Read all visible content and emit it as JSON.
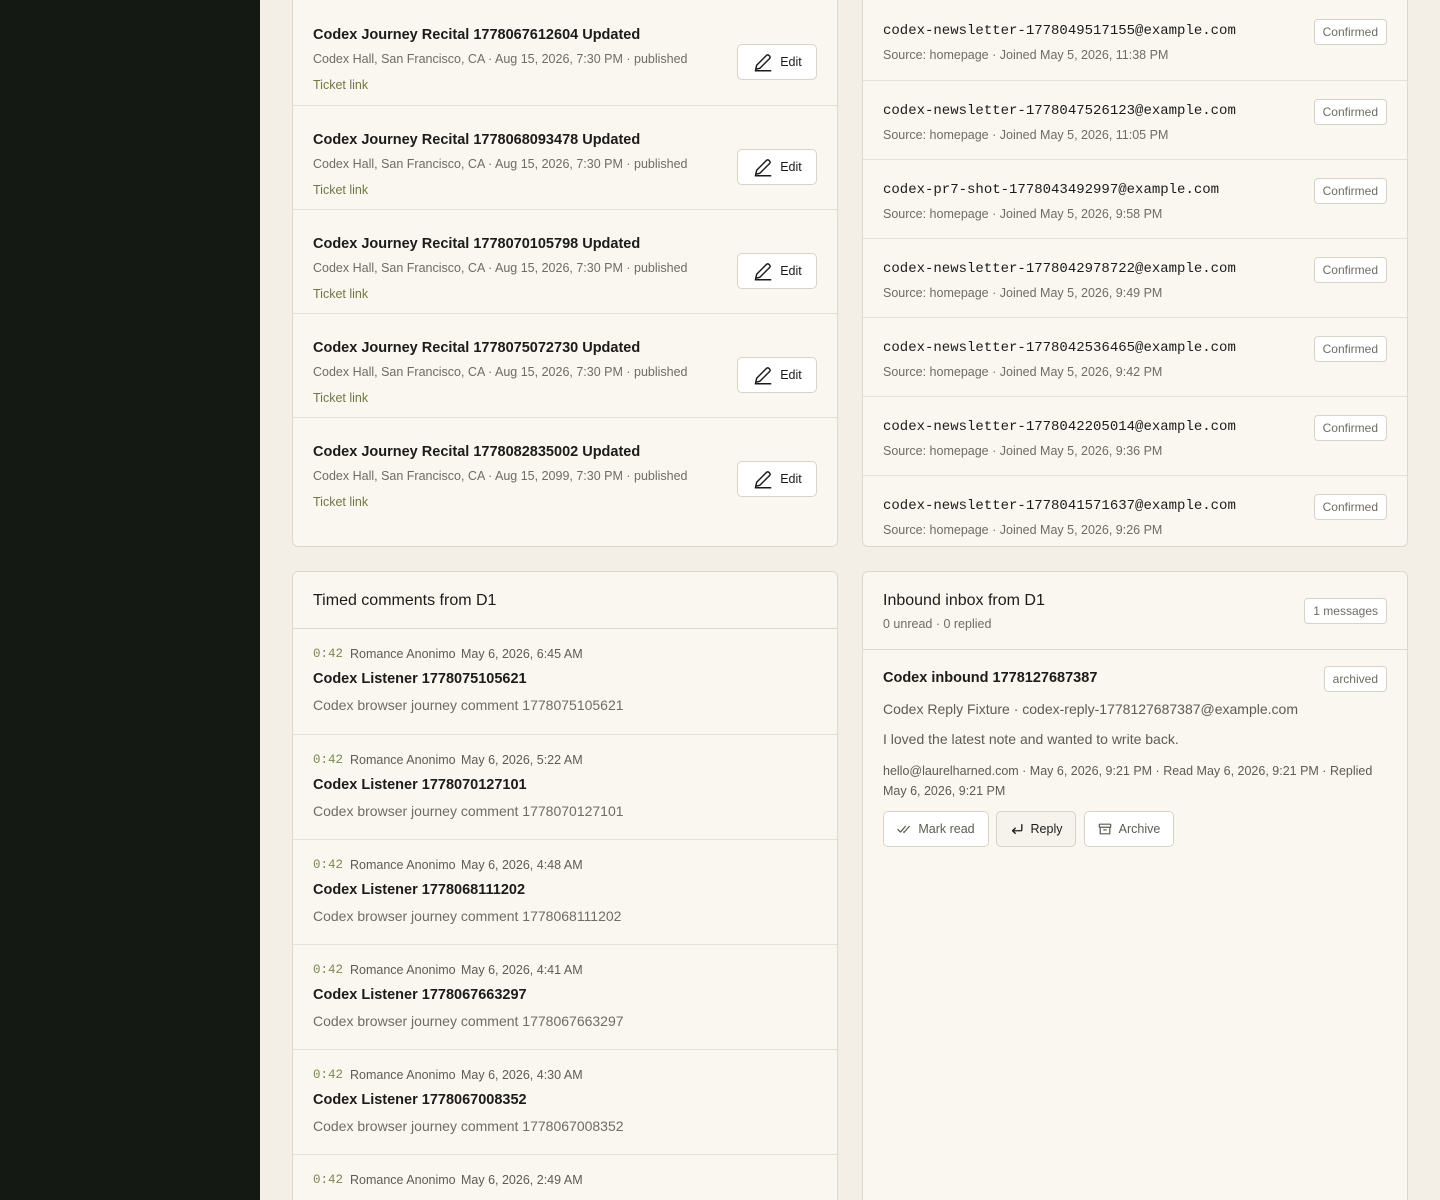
{
  "events": {
    "edit_label": "Edit",
    "items": [
      {
        "title": "Codex Journey Recital 1778067612604 Updated",
        "meta": "Codex Hall, San Francisco, CA · Aug 15, 2026, 7:30 PM · published",
        "link": "Ticket link"
      },
      {
        "title": "Codex Journey Recital 1778068093478 Updated",
        "meta": "Codex Hall, San Francisco, CA · Aug 15, 2026, 7:30 PM · published",
        "link": "Ticket link"
      },
      {
        "title": "Codex Journey Recital 1778070105798 Updated",
        "meta": "Codex Hall, San Francisco, CA · Aug 15, 2026, 7:30 PM · published",
        "link": "Ticket link"
      },
      {
        "title": "Codex Journey Recital 1778075072730 Updated",
        "meta": "Codex Hall, San Francisco, CA · Aug 15, 2026, 7:30 PM · published",
        "link": "Ticket link"
      },
      {
        "title": "Codex Journey Recital 1778082835002 Updated",
        "meta": "Codex Hall, San Francisco, CA · Aug 15, 2099, 7:30 PM · published",
        "link": "Ticket link"
      }
    ]
  },
  "subscribers": {
    "items": [
      {
        "email": "codex-newsletter-1778049517155@example.com",
        "meta": "Source: homepage · Joined May 5, 2026, 11:38 PM",
        "status": "Confirmed"
      },
      {
        "email": "codex-newsletter-1778047526123@example.com",
        "meta": "Source: homepage · Joined May 5, 2026, 11:05 PM",
        "status": "Confirmed"
      },
      {
        "email": "codex-pr7-shot-1778043492997@example.com",
        "meta": "Source: homepage · Joined May 5, 2026, 9:58 PM",
        "status": "Confirmed"
      },
      {
        "email": "codex-newsletter-1778042978722@example.com",
        "meta": "Source: homepage · Joined May 5, 2026, 9:49 PM",
        "status": "Confirmed"
      },
      {
        "email": "codex-newsletter-1778042536465@example.com",
        "meta": "Source: homepage · Joined May 5, 2026, 9:42 PM",
        "status": "Confirmed"
      },
      {
        "email": "codex-newsletter-1778042205014@example.com",
        "meta": "Source: homepage · Joined May 5, 2026, 9:36 PM",
        "status": "Confirmed"
      },
      {
        "email": "codex-newsletter-1778041571637@example.com",
        "meta": "Source: homepage · Joined May 5, 2026, 9:26 PM",
        "status": "Confirmed"
      }
    ]
  },
  "comments": {
    "title": "Timed comments from D1",
    "items": [
      {
        "time": "0:42",
        "author": "Romance Anonimo",
        "date": "May 6, 2026, 6:45 AM",
        "name": "Codex Listener 1778075105621",
        "body": "Codex browser journey comment 1778075105621"
      },
      {
        "time": "0:42",
        "author": "Romance Anonimo",
        "date": "May 6, 2026, 5:22 AM",
        "name": "Codex Listener 1778070127101",
        "body": "Codex browser journey comment 1778070127101"
      },
      {
        "time": "0:42",
        "author": "Romance Anonimo",
        "date": "May 6, 2026, 4:48 AM",
        "name": "Codex Listener 1778068111202",
        "body": "Codex browser journey comment 1778068111202"
      },
      {
        "time": "0:42",
        "author": "Romance Anonimo",
        "date": "May 6, 2026, 4:41 AM",
        "name": "Codex Listener 1778067663297",
        "body": "Codex browser journey comment 1778067663297"
      },
      {
        "time": "0:42",
        "author": "Romance Anonimo",
        "date": "May 6, 2026, 4:30 AM",
        "name": "Codex Listener 1778067008352",
        "body": "Codex browser journey comment 1778067008352"
      },
      {
        "time": "0:42",
        "author": "Romance Anonimo",
        "date": "May 6, 2026, 2:49 AM",
        "name": "",
        "body": ""
      }
    ]
  },
  "inbox": {
    "title": "Inbound inbox from D1",
    "subtitle": "0 unread · 0 replied",
    "count": "1 messages",
    "message": {
      "subject": "Codex inbound 1778127687387",
      "status": "archived",
      "from": "Codex Reply Fixture · codex-reply-1778127687387@example.com",
      "body": "I loved the latest note and wanted to write back.",
      "meta": "hello@laurelharned.com · May 6, 2026, 9:21 PM · Read May 6, 2026, 9:21 PM · Replied May 6, 2026, 9:21 PM"
    },
    "actions": {
      "mark_read": "Mark read",
      "reply": "Reply",
      "archive": "Archive"
    }
  },
  "colors": {
    "sidebar": "#151914",
    "background": "#f3efe6",
    "card": "#faf7f0",
    "accent": "#6d7a45"
  }
}
